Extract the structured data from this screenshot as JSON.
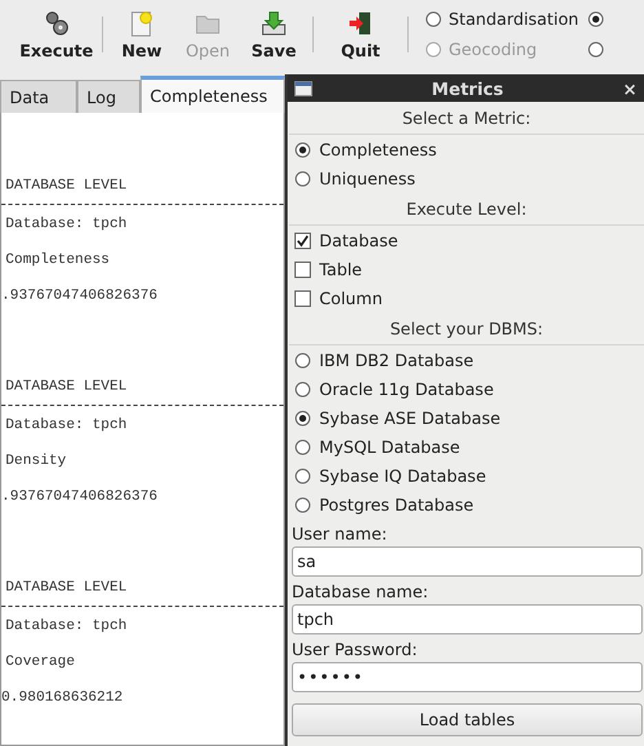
{
  "toolbar": {
    "buttons": [
      {
        "label": "Execute",
        "kind": "execute",
        "disabled": false
      },
      {
        "label": "New",
        "kind": "new",
        "disabled": false
      },
      {
        "label": "Open",
        "kind": "open",
        "disabled": true
      },
      {
        "label": "Save",
        "kind": "save",
        "disabled": false
      },
      {
        "label": "Quit",
        "kind": "quit",
        "disabled": false
      }
    ],
    "options": [
      {
        "label": "Standardisation",
        "selected": false,
        "disabled": false
      },
      {
        "selected": true,
        "disabled": false
      },
      {
        "label": "Geocoding",
        "selected": false,
        "disabled": true
      },
      {
        "selected": false,
        "disabled": false
      }
    ]
  },
  "tabs": [
    {
      "label": "Data",
      "selected": false
    },
    {
      "label": "Log",
      "selected": false
    },
    {
      "label": "Completeness",
      "selected": true
    }
  ],
  "log": [
    {
      "level": "DATABASE LEVEL",
      "database": "Database: tpch",
      "metric": "Completeness",
      "value": ".93767047406826376"
    },
    {
      "level": "DATABASE LEVEL",
      "database": "Database: tpch",
      "metric": "Density",
      "value": ".93767047406826376"
    },
    {
      "level": "DATABASE LEVEL",
      "database": "Database: tpch",
      "metric": "Coverage",
      "value": "0.980168636212"
    }
  ],
  "dialog": {
    "title": "Metrics",
    "close": "×",
    "sections": [
      {
        "heading": "Select a Metric:",
        "kind": "radio",
        "items": [
          {
            "label": "Completeness",
            "selected": true
          },
          {
            "label": "Uniqueness",
            "selected": false
          }
        ]
      },
      {
        "heading": "Execute Level:",
        "kind": "checkbox",
        "items": [
          {
            "label": "Database",
            "checked": true
          },
          {
            "label": "Table",
            "checked": false
          },
          {
            "label": "Column",
            "checked": false
          }
        ]
      },
      {
        "heading": "Select your DBMS:",
        "kind": "radio",
        "items": [
          {
            "label": "IBM DB2 Database",
            "selected": false
          },
          {
            "label": "Oracle 11g Database",
            "selected": false
          },
          {
            "label": "Sybase ASE Database",
            "selected": true
          },
          {
            "label": "MySQL Database",
            "selected": false
          },
          {
            "label": "Sybase IQ Database",
            "selected": false
          },
          {
            "label": "Postgres Database",
            "selected": false
          }
        ]
      }
    ],
    "fields": [
      {
        "label": "User name:",
        "value": "sa",
        "kind": "text"
      },
      {
        "label": "Database name:",
        "value": "tpch",
        "kind": "text"
      },
      {
        "label": "User Password:",
        "value": "••••••",
        "kind": "password"
      }
    ],
    "button": "Load tables"
  }
}
